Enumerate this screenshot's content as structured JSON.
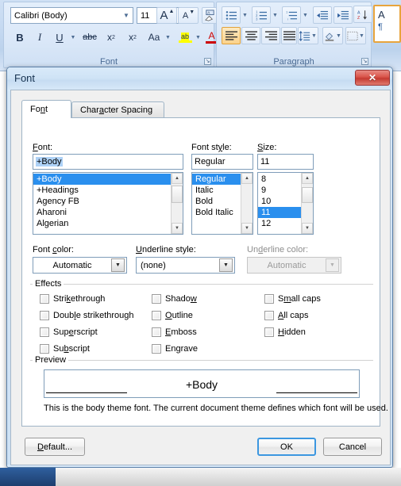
{
  "ribbon": {
    "font_group": {
      "label": "Font",
      "dialog_launcher_icon": "dialog-launcher-icon",
      "font_name_combo": {
        "value": "Calibri (Body)",
        "arrow_icon": "chevron-down-icon"
      },
      "font_size_combo": {
        "value": "11",
        "arrow_icon": "chevron-down-icon"
      },
      "grow_font": "A",
      "shrink_font": "A",
      "clear_formatting": "clear-formatting-icon",
      "bold": "B",
      "italic": "I",
      "underline": "U",
      "strikethrough": "abc",
      "subscript": "x",
      "subscript_sub": "2",
      "superscript": "x",
      "superscript_sup": "2",
      "change_case": "Aa",
      "highlight": "ab",
      "font_color": "A"
    },
    "paragraph_group": {
      "label": "Paragraph",
      "dialog_launcher_icon": "dialog-launcher-icon",
      "bullets": "bullets-icon",
      "numbering": "numbering-icon",
      "multilevel_list": "multilevel-list-icon",
      "decrease_indent": "decrease-indent-icon",
      "increase_indent": "increase-indent-icon",
      "sort": "sort-icon",
      "show_marks": "¶",
      "align_left": "align-left-icon",
      "align_center": "align-center-icon",
      "align_right": "align-right-icon",
      "justify": "justify-icon",
      "line_spacing": "line-spacing-icon",
      "shading": "shading-icon",
      "borders": "borders-icon"
    },
    "styles_group": {
      "preview_letter": "A",
      "preview_mark": "¶"
    }
  },
  "dialog": {
    "title": "Font",
    "close_label": "✕",
    "tabs": [
      {
        "label_pre": "Fo",
        "label_acc": "n",
        "label_post": "t",
        "selected": true,
        "name": "tab-font"
      },
      {
        "label_pre": "Char",
        "label_acc": "a",
        "label_post": "cter Spacing",
        "selected": false,
        "name": "tab-character-spacing"
      }
    ],
    "font_section": {
      "font_label_pre": "",
      "font_label_acc": "F",
      "font_label_post": "ont:",
      "font_value": "+Body",
      "font_options": [
        "+Body",
        "+Headings",
        "Agency FB",
        "Aharoni",
        "Algerian"
      ],
      "font_selected_index": 0,
      "style_label_pre": "Font st",
      "style_label_acc": "y",
      "style_label_post": "le:",
      "style_value": "Regular",
      "style_options": [
        "Regular",
        "Italic",
        "Bold",
        "Bold Italic"
      ],
      "style_selected_index": 0,
      "size_label_pre": "",
      "size_label_acc": "S",
      "size_label_post": "ize:",
      "size_value": "11",
      "size_options": [
        "8",
        "9",
        "10",
        "11",
        "12"
      ],
      "size_selected_index": 3
    },
    "color_row": {
      "font_color_label_pre": "Font ",
      "font_color_label_acc": "c",
      "font_color_label_post": "olor:",
      "font_color_value": "Automatic",
      "underline_style_label_pre": "",
      "underline_style_label_acc": "U",
      "underline_style_label_post": "nderline style:",
      "underline_style_value": "(none)",
      "underline_color_label_pre": "Un",
      "underline_color_label_acc": "d",
      "underline_color_label_post": "erline color:",
      "underline_color_value": "Automatic",
      "underline_color_disabled": true,
      "arrow_icon": "chevron-down-icon"
    },
    "effects": {
      "caption": "Effects",
      "items": [
        {
          "pre": "Stri",
          "acc": "k",
          "post": "ethrough",
          "checked": false,
          "col": 0,
          "row": 0,
          "name": "checkbox-strikethrough"
        },
        {
          "pre": "Doub",
          "acc": "l",
          "post": "e strikethrough",
          "checked": false,
          "col": 0,
          "row": 1,
          "name": "checkbox-double-strikethrough"
        },
        {
          "pre": "Sup",
          "acc": "e",
          "post": "rscript",
          "checked": false,
          "col": 0,
          "row": 2,
          "name": "checkbox-superscript"
        },
        {
          "pre": "Su",
          "acc": "b",
          "post": "script",
          "checked": false,
          "col": 0,
          "row": 3,
          "name": "checkbox-subscript"
        },
        {
          "pre": "Shado",
          "acc": "w",
          "post": "",
          "checked": false,
          "col": 1,
          "row": 0,
          "name": "checkbox-shadow"
        },
        {
          "pre": "",
          "acc": "O",
          "post": "utline",
          "checked": false,
          "col": 1,
          "row": 1,
          "name": "checkbox-outline"
        },
        {
          "pre": "",
          "acc": "E",
          "post": "mboss",
          "checked": false,
          "col": 1,
          "row": 2,
          "name": "checkbox-emboss"
        },
        {
          "pre": "En",
          "acc": "g",
          "post": "rave",
          "checked": false,
          "col": 1,
          "row": 3,
          "name": "checkbox-engrave"
        },
        {
          "pre": "S",
          "acc": "m",
          "post": "all caps",
          "checked": false,
          "col": 2,
          "row": 0,
          "name": "checkbox-small-caps"
        },
        {
          "pre": "",
          "acc": "A",
          "post": "ll caps",
          "checked": false,
          "col": 2,
          "row": 1,
          "name": "checkbox-all-caps"
        },
        {
          "pre": "",
          "acc": "H",
          "post": "idden",
          "checked": false,
          "col": 2,
          "row": 2,
          "name": "checkbox-hidden"
        }
      ]
    },
    "preview": {
      "caption": "Preview",
      "sample_text": "+Body",
      "description": "This is the body theme font. The current document theme defines which font will be used."
    },
    "buttons": {
      "default_pre": "",
      "default_acc": "D",
      "default_post": "efault...",
      "ok": "OK",
      "cancel": "Cancel"
    }
  },
  "colors": {
    "selection_blue": "#2a8fee",
    "title_blue": "#cfe3f6",
    "close_red": "#c43a31",
    "default_btn_border": "#3c97e0",
    "dialog_face": "#f0f0f0"
  }
}
